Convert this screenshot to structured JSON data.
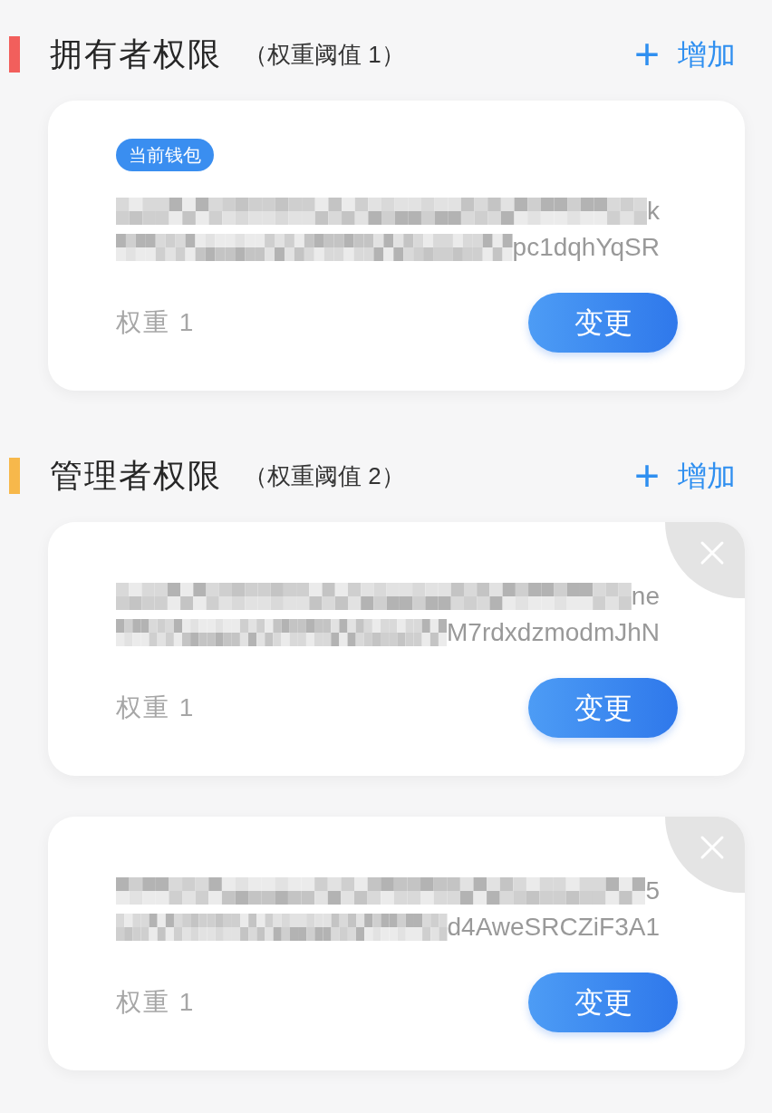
{
  "sections": [
    {
      "color": "#f25f5c",
      "title": "拥有者权限",
      "threshold": "（权重阈值 1）",
      "add": {
        "icon": "+",
        "label": "增加"
      },
      "cards": [
        {
          "badge": "当前钱包",
          "removable": false,
          "address_lines": [
            {
              "redacted": true,
              "visible": "k"
            },
            {
              "redacted": true,
              "visible": "pc1dqhYqSR"
            }
          ],
          "weight": "权重 1",
          "button": "变更"
        }
      ]
    },
    {
      "color": "#f7b84b",
      "title": "管理者权限",
      "threshold": "（权重阈值 2）",
      "add": {
        "icon": "+",
        "label": "增加"
      },
      "cards": [
        {
          "removable": true,
          "address_lines": [
            {
              "redacted": true,
              "visible": "ne"
            },
            {
              "redacted": true,
              "visible": "M7rdxdzmodmJhN"
            }
          ],
          "weight": "权重 1",
          "button": "变更"
        },
        {
          "removable": true,
          "address_lines": [
            {
              "redacted": true,
              "visible": "5"
            },
            {
              "redacted": true,
              "visible": "d4AweSRCZiF3A1"
            }
          ],
          "weight": "权重 1",
          "button": "变更"
        }
      ]
    }
  ]
}
